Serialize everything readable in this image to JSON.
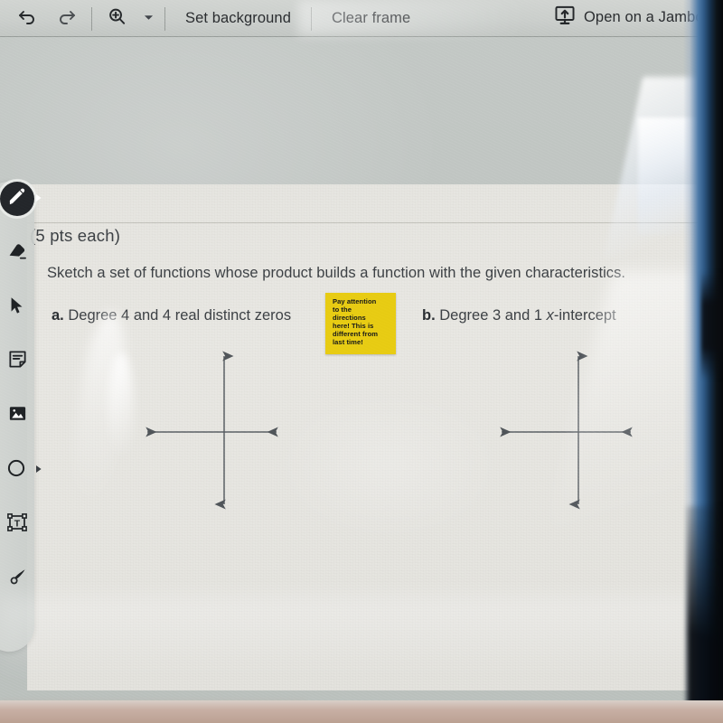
{
  "app": {
    "name": "Jamboard"
  },
  "toolbar": {
    "undo_icon": "undo-icon",
    "redo_icon": "redo-icon",
    "zoom_icon": "zoom-in-icon",
    "zoom_caret_icon": "chevron-down-icon",
    "set_background_label": "Set background",
    "clear_frame_label": "Clear frame",
    "open_jamboard_label": "Open on a Jamboa",
    "open_jamboard_icon": "open-on-device-icon"
  },
  "toolrail": {
    "items": [
      {
        "name": "pen-tool",
        "icon": "pen-icon",
        "active": true
      },
      {
        "name": "eraser-tool",
        "icon": "eraser-icon",
        "active": false
      },
      {
        "name": "select-tool",
        "icon": "cursor-arrow-icon",
        "active": false
      },
      {
        "name": "sticky-note-tool",
        "icon": "sticky-note-icon",
        "active": false
      },
      {
        "name": "image-tool",
        "icon": "image-icon",
        "active": false
      },
      {
        "name": "shape-tool",
        "icon": "circle-shape-icon",
        "active": false
      },
      {
        "name": "text-box-tool",
        "icon": "text-box-icon",
        "active": false
      },
      {
        "name": "laser-pointer-tool",
        "icon": "laser-pointer-icon",
        "active": false
      }
    ]
  },
  "worksheet": {
    "points_note": "(5 pts each)",
    "prompt": "Sketch a set of functions whose product builds a function with the given characteristics.",
    "item_a_marker": "a.",
    "item_a_text": "Degree 4 and 4 real distinct zeros",
    "item_b_marker": "b.",
    "item_b_text_pre": "Degree 3 and 1 ",
    "item_b_text_var": "x",
    "item_b_text_post": "-intercept",
    "axes": [
      {
        "name": "axes-diagram-a",
        "label": "blank coordinate axes for part a"
      },
      {
        "name": "axes-diagram-b",
        "label": "blank coordinate axes for part b"
      }
    ]
  },
  "sticky_note": {
    "text": "Pay attention\nto the\ndirections\nhere!  This is\ndifferent from\nlast time!",
    "color": "#e8cc13",
    "text_color": "#16181a"
  },
  "colors": {
    "toolbar_bg": "#cbcfcc",
    "canvas_bg": "#bfc4c1",
    "paper_bg": "#e7e6e1",
    "ink": "#3d4145",
    "sticky_yellow": "#e8cc13",
    "screen_edge_blue": "#2f5a86"
  }
}
